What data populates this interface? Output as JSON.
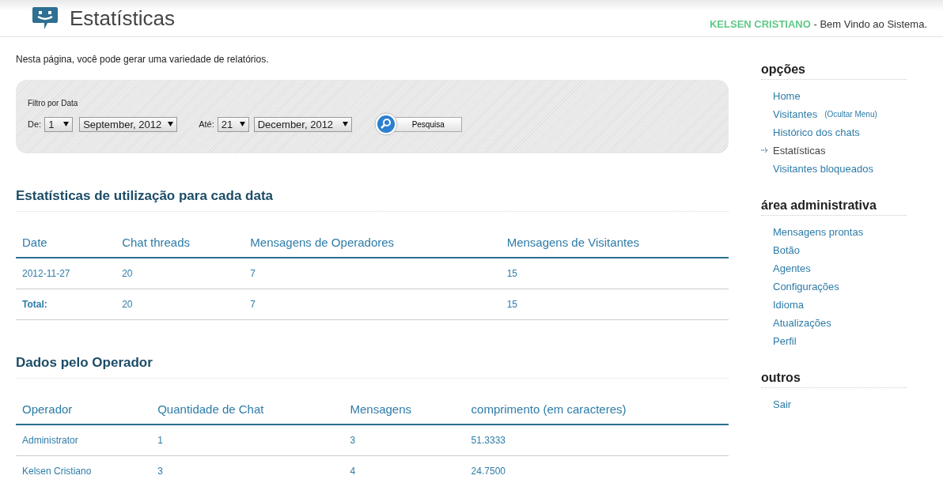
{
  "header": {
    "title": "Estatísticas",
    "user": "KELSEN CRISTIANO",
    "welcome": " - Bem Vindo ao Sistema."
  },
  "intro": "Nesta página, você pode gerar uma variedade de relatórios.",
  "filter": {
    "title": "Filtro por Data",
    "from_label": "De:",
    "from_day": "1",
    "from_month": "September, 2012",
    "to_label": "Até:",
    "to_day": "21",
    "to_month": "December, 2012",
    "button": "Pesquisa"
  },
  "date_stats": {
    "title": "Estatísticas de utilização para cada data",
    "columns": [
      "Date",
      "Chat threads",
      "Mensagens de Operadores",
      "Mensagens de Visitantes"
    ],
    "rows": [
      {
        "kind": "data",
        "cells": [
          "2012-11-27",
          "20",
          "7",
          "15"
        ]
      },
      {
        "kind": "total",
        "cells": [
          "Total:",
          "20",
          "7",
          "15"
        ]
      }
    ]
  },
  "operator_stats": {
    "title": "Dados pelo Operador",
    "columns": [
      "Operador",
      "Quantidade de Chat",
      "Mensagens",
      "comprimento (em caracteres)"
    ],
    "rows": [
      {
        "kind": "data",
        "cells": [
          "Administrator",
          "1",
          "3",
          "51.3333"
        ]
      },
      {
        "kind": "data",
        "cells": [
          "Kelsen Cristiano",
          "3",
          "4",
          "24.7500"
        ]
      }
    ]
  },
  "sidebar": [
    {
      "title": "opções",
      "items": [
        {
          "label": "Home",
          "selected": false
        },
        {
          "label": "Visitantes",
          "note": "(Ocultar Menu)",
          "selected": false
        },
        {
          "label": "Histórico dos chats",
          "selected": false
        },
        {
          "label": "Estatísticas",
          "selected": true
        },
        {
          "label": "Visitantes bloqueados",
          "selected": false
        }
      ]
    },
    {
      "title": "área administrativa",
      "items": [
        {
          "label": "Mensagens prontas",
          "selected": false
        },
        {
          "label": "Botão",
          "selected": false
        },
        {
          "label": "Agentes",
          "selected": false
        },
        {
          "label": "Configurações",
          "selected": false
        },
        {
          "label": "Idioma",
          "selected": false
        },
        {
          "label": "Atualizações",
          "selected": false
        },
        {
          "label": "Perfil",
          "selected": false
        }
      ]
    },
    {
      "title": "outros",
      "items": [
        {
          "label": "Sair",
          "selected": false
        }
      ]
    }
  ]
}
